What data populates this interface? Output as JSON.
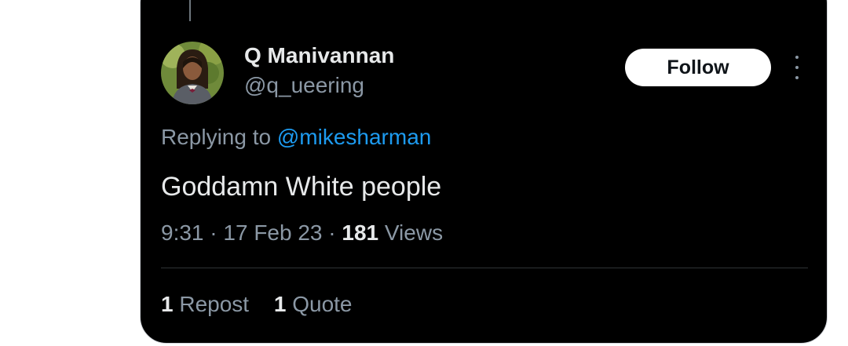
{
  "tweet": {
    "author": {
      "display_name": "Q Manivannan",
      "handle": "@q_ueering"
    },
    "follow_label": "Follow",
    "replying_prefix": "Replying to",
    "replying_to": "@mikesharman",
    "text": "Goddamn White people",
    "time": "9:31",
    "separator": "·",
    "date": "17 Feb 23",
    "views_count": "181",
    "views_label": "Views",
    "reposts_count": "1",
    "reposts_label": "Repost",
    "quotes_count": "1",
    "quotes_label": "Quote"
  },
  "colors": {
    "background": "#000000",
    "primary_text": "#e7e9ea",
    "secondary_text": "#8b98a5",
    "link": "#1d9bf0",
    "follow_bg": "#ffffff"
  },
  "icons": [
    "more-icon",
    "avatar"
  ]
}
